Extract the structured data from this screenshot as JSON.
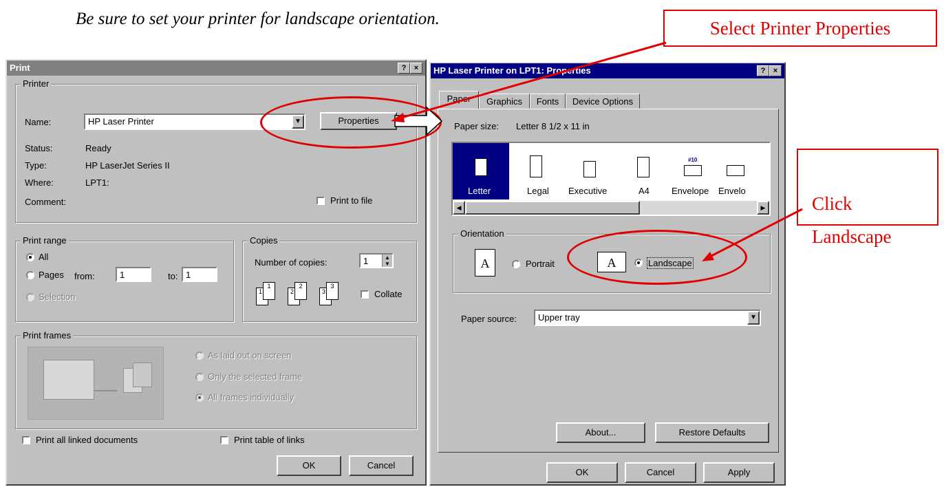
{
  "instruction": "Be sure to set your printer for landscape orientation.",
  "callouts": {
    "select_properties": "Select Printer Properties",
    "click_landscape": "Click\nLandscape"
  },
  "colors": {
    "accent_red": "#e00000",
    "title_active": "#000080",
    "title_inactive": "#808080",
    "face": "#c0c0c0"
  },
  "print_dialog": {
    "title": "Print",
    "help_btn": "?",
    "close_btn": "×",
    "printer_group": "Printer",
    "name_label": "Name:",
    "name_value": "HP Laser Printer",
    "properties_btn": "Properties",
    "status_label": "Status:",
    "status_value": "Ready",
    "type_label": "Type:",
    "type_value": "HP LaserJet Series II",
    "where_label": "Where:",
    "where_value": "LPT1:",
    "comment_label": "Comment:",
    "print_to_file": "Print to file",
    "print_range_group": "Print range",
    "range_all": "All",
    "range_pages": "Pages",
    "from_label": "from:",
    "from_value": "1",
    "to_label": "to:",
    "to_value": "1",
    "range_selection": "Selection",
    "copies_group": "Copies",
    "number_of_copies_label": "Number of copies:",
    "copies_value": "1",
    "collate": "Collate",
    "collate_icons": [
      "1",
      "1",
      "2",
      "2",
      "3",
      "3"
    ],
    "print_frames_group": "Print frames",
    "frames_as_laid": "As laid out on screen",
    "frames_selected": "Only the selected frame",
    "frames_individually": "All frames individually",
    "print_linked": "Print all linked documents",
    "print_table_links": "Print table of links",
    "ok": "OK",
    "cancel": "Cancel"
  },
  "props_dialog": {
    "title": "HP Laser Printer on LPT1: Properties",
    "help_btn": "?",
    "close_btn": "×",
    "tabs": [
      "Paper",
      "Graphics",
      "Fonts",
      "Device Options"
    ],
    "paper_size_label": "Paper size:",
    "paper_size_value": "Letter 8 1/2 x 11 in",
    "papers": [
      "Letter",
      "Legal",
      "Executive",
      "A4",
      "Envelope",
      "Envelo"
    ],
    "envelope_badge": "#10",
    "orientation_group": "Orientation",
    "portrait": "Portrait",
    "landscape": "Landscape",
    "orientation_glyph": "A",
    "paper_source_label": "Paper source:",
    "paper_source_value": "Upper tray",
    "about_btn": "About...",
    "restore_btn": "Restore Defaults",
    "ok": "OK",
    "cancel": "Cancel",
    "apply": "Apply"
  }
}
